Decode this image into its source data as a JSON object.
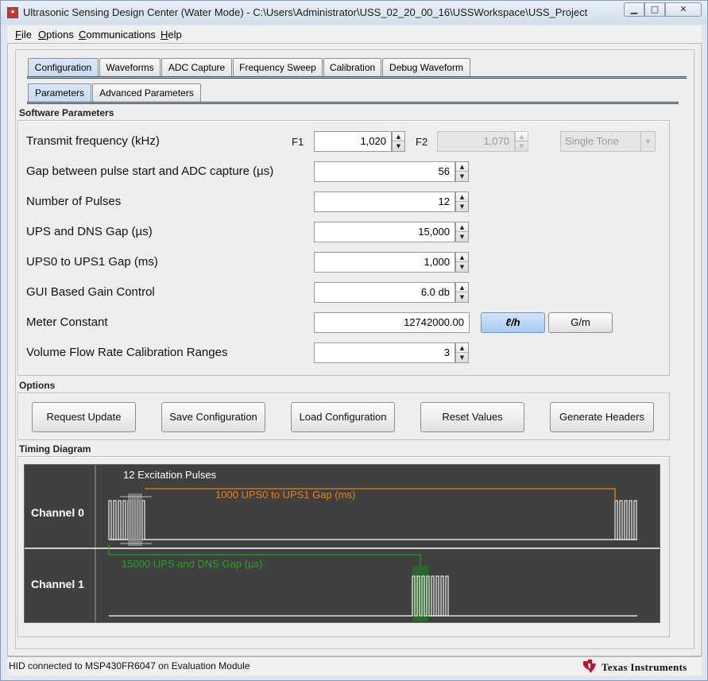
{
  "window": {
    "title": "Ultrasonic Sensing Design Center (Water Mode) - C:\\Users\\Administrator\\USS_02_20_00_16\\USSWorkspace\\USS_Project",
    "minimize": "▁",
    "maximize": "□",
    "close": "✕"
  },
  "menu": [
    {
      "accel": "F",
      "rest": "ile"
    },
    {
      "accel": "O",
      "rest": "ptions"
    },
    {
      "accel": "C",
      "rest": "ommunications"
    },
    {
      "accel": "H",
      "rest": "elp"
    }
  ],
  "tabs": [
    "Configuration",
    "Waveforms",
    "ADC Capture",
    "Frequency Sweep",
    "Calibration",
    "Debug Waveform"
  ],
  "subtabs": [
    "Parameters",
    "Advanced Parameters"
  ],
  "software_parameters": {
    "title": "Software Parameters",
    "f1_label": "F1",
    "f2_label": "F2",
    "f1_value": "1,020",
    "f2_value": "1,070",
    "tone_mode": "Single Tone",
    "rows": [
      {
        "label": "Transmit frequency (kHz)"
      },
      {
        "label": "Gap between pulse start and ADC capture (µs)",
        "value": "56"
      },
      {
        "label": "Number of Pulses",
        "value": "12"
      },
      {
        "label": "UPS and DNS Gap (µs)",
        "value": "15,000"
      },
      {
        "label": "UPS0 to UPS1 Gap (ms)",
        "value": "1,000"
      },
      {
        "label": "GUI Based Gain Control",
        "value": "6.0 db"
      },
      {
        "label": "Meter Constant",
        "value": "12742000.00"
      },
      {
        "label": "Volume Flow Rate Calibration Ranges",
        "value": "3"
      }
    ],
    "unit_buttons": [
      "ℓ/h",
      "G/m"
    ]
  },
  "options": {
    "title": "Options",
    "buttons": [
      "Request Update",
      "Save Configuration",
      "Load Configuration",
      "Reset Values",
      "Generate Headers"
    ]
  },
  "timing_diagram": {
    "title": "Timing Diagram",
    "channels": [
      "Channel 0",
      "Channel 1"
    ],
    "annotations": {
      "pulses": "12 Excitation Pulses",
      "ups_gap": "1000 UPS0 to UPS1 Gap (ms)",
      "dns_gap": "15000 UPS and DNS Gap (µs)"
    },
    "colors": {
      "background": "#404040",
      "ups_gap": "#e8811a",
      "dns_gap": "#1fa51f",
      "pulse": "#ffffff"
    }
  },
  "status": {
    "text": "HID connected to MSP430FR6047 on Evaluation Module",
    "brand": "Texas Instruments"
  }
}
